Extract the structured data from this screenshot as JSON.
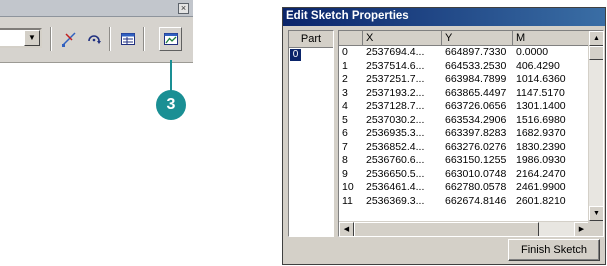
{
  "toolbar": {
    "close_glyph": "×",
    "combo_arrow": "▼",
    "icons": [
      "sketch-tool-icon",
      "rotate-tool-icon",
      "attributes-icon",
      "sketch-properties-icon"
    ]
  },
  "callout": {
    "number": "3",
    "color": "#1a8f94"
  },
  "window": {
    "title": "Edit Sketch Properties",
    "part_header": "Part",
    "parts": [
      "0"
    ],
    "columns": [
      "",
      "X",
      "Y",
      "M"
    ],
    "rows": [
      [
        "0",
        "2537694.4...",
        "664897.7330",
        "0.0000"
      ],
      [
        "1",
        "2537514.6...",
        "664533.2530",
        "406.4290"
      ],
      [
        "2",
        "2537251.7...",
        "663984.7899",
        "1014.6360"
      ],
      [
        "3",
        "2537193.2...",
        "663865.4497",
        "1147.5170"
      ],
      [
        "4",
        "2537128.7...",
        "663726.0656",
        "1301.1400"
      ],
      [
        "5",
        "2537030.2...",
        "663534.2906",
        "1516.6980"
      ],
      [
        "6",
        "2536935.3...",
        "663397.8283",
        "1682.9370"
      ],
      [
        "7",
        "2536852.4...",
        "663276.0276",
        "1830.2390"
      ],
      [
        "8",
        "2536760.6...",
        "663150.1255",
        "1986.0930"
      ],
      [
        "9",
        "2536650.5...",
        "663010.0748",
        "2164.2470"
      ],
      [
        "10",
        "2536461.4...",
        "662780.0578",
        "2461.9900"
      ],
      [
        "11",
        "2536369.3...",
        "662674.8146",
        "2601.8210"
      ]
    ],
    "finish_label": "Finish Sketch"
  }
}
